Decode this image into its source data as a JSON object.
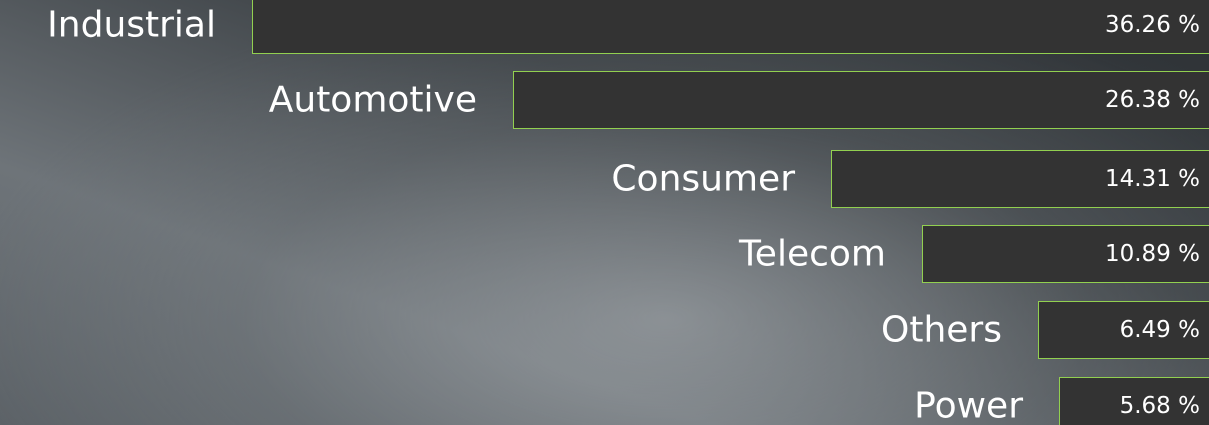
{
  "chart_data": {
    "type": "bar",
    "orientation": "horizontal",
    "categories": [
      "Industrial",
      "Automotive",
      "Consumer",
      "Telecom",
      "Others",
      "Power"
    ],
    "values": [
      36.26,
      26.38,
      14.31,
      10.89,
      6.49,
      5.68
    ],
    "value_labels": [
      "36.26 %",
      "26.38 %",
      "14.31 %",
      "10.89 %",
      "6.49 %",
      "5.68 %"
    ],
    "unit": "%",
    "grid": false,
    "legend": "none"
  },
  "colors": {
    "bar_fill": "#333333",
    "bar_border": "#92d050",
    "text": "#ffffff"
  }
}
